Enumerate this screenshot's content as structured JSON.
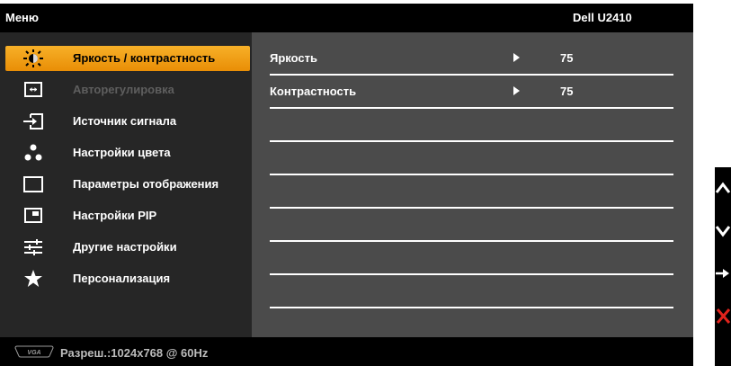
{
  "header": {
    "menu_title": "Меню",
    "model": "Dell U2410"
  },
  "menu": {
    "items": [
      {
        "label": "Яркость / контрастность",
        "icon": "brightness-icon",
        "state": "selected"
      },
      {
        "label": "Авторегулировка",
        "icon": "auto-adjust-icon",
        "state": "disabled"
      },
      {
        "label": "Источник сигнала",
        "icon": "input-source-icon",
        "state": "normal"
      },
      {
        "label": "Настройки цвета",
        "icon": "color-settings-icon",
        "state": "normal"
      },
      {
        "label": "Параметры отображения",
        "icon": "display-settings-icon",
        "state": "normal"
      },
      {
        "label": "Настройки PIP",
        "icon": "pip-icon",
        "state": "normal"
      },
      {
        "label": "Другие настройки",
        "icon": "other-settings-icon",
        "state": "normal"
      },
      {
        "label": "Персонализация",
        "icon": "star-icon",
        "state": "normal"
      }
    ]
  },
  "settings": {
    "rows": [
      {
        "label": "Яркость",
        "value": "75"
      },
      {
        "label": "Контрастность",
        "value": "75"
      },
      {
        "label": "",
        "value": ""
      },
      {
        "label": "",
        "value": ""
      },
      {
        "label": "",
        "value": ""
      },
      {
        "label": "",
        "value": ""
      },
      {
        "label": "",
        "value": ""
      },
      {
        "label": "",
        "value": ""
      }
    ]
  },
  "footer": {
    "connector_icon": "vga-icon",
    "resolution": "Разреш.:1024x768 @ 60Hz"
  },
  "side_buttons": [
    "up-arrow-icon",
    "down-arrow-icon",
    "right-arrow-icon",
    "exit-x-icon"
  ],
  "colors": {
    "accent": "#f0a01a",
    "exit": "#e0231c",
    "panel_left": "#262626",
    "panel_right": "#4b4b4b"
  }
}
